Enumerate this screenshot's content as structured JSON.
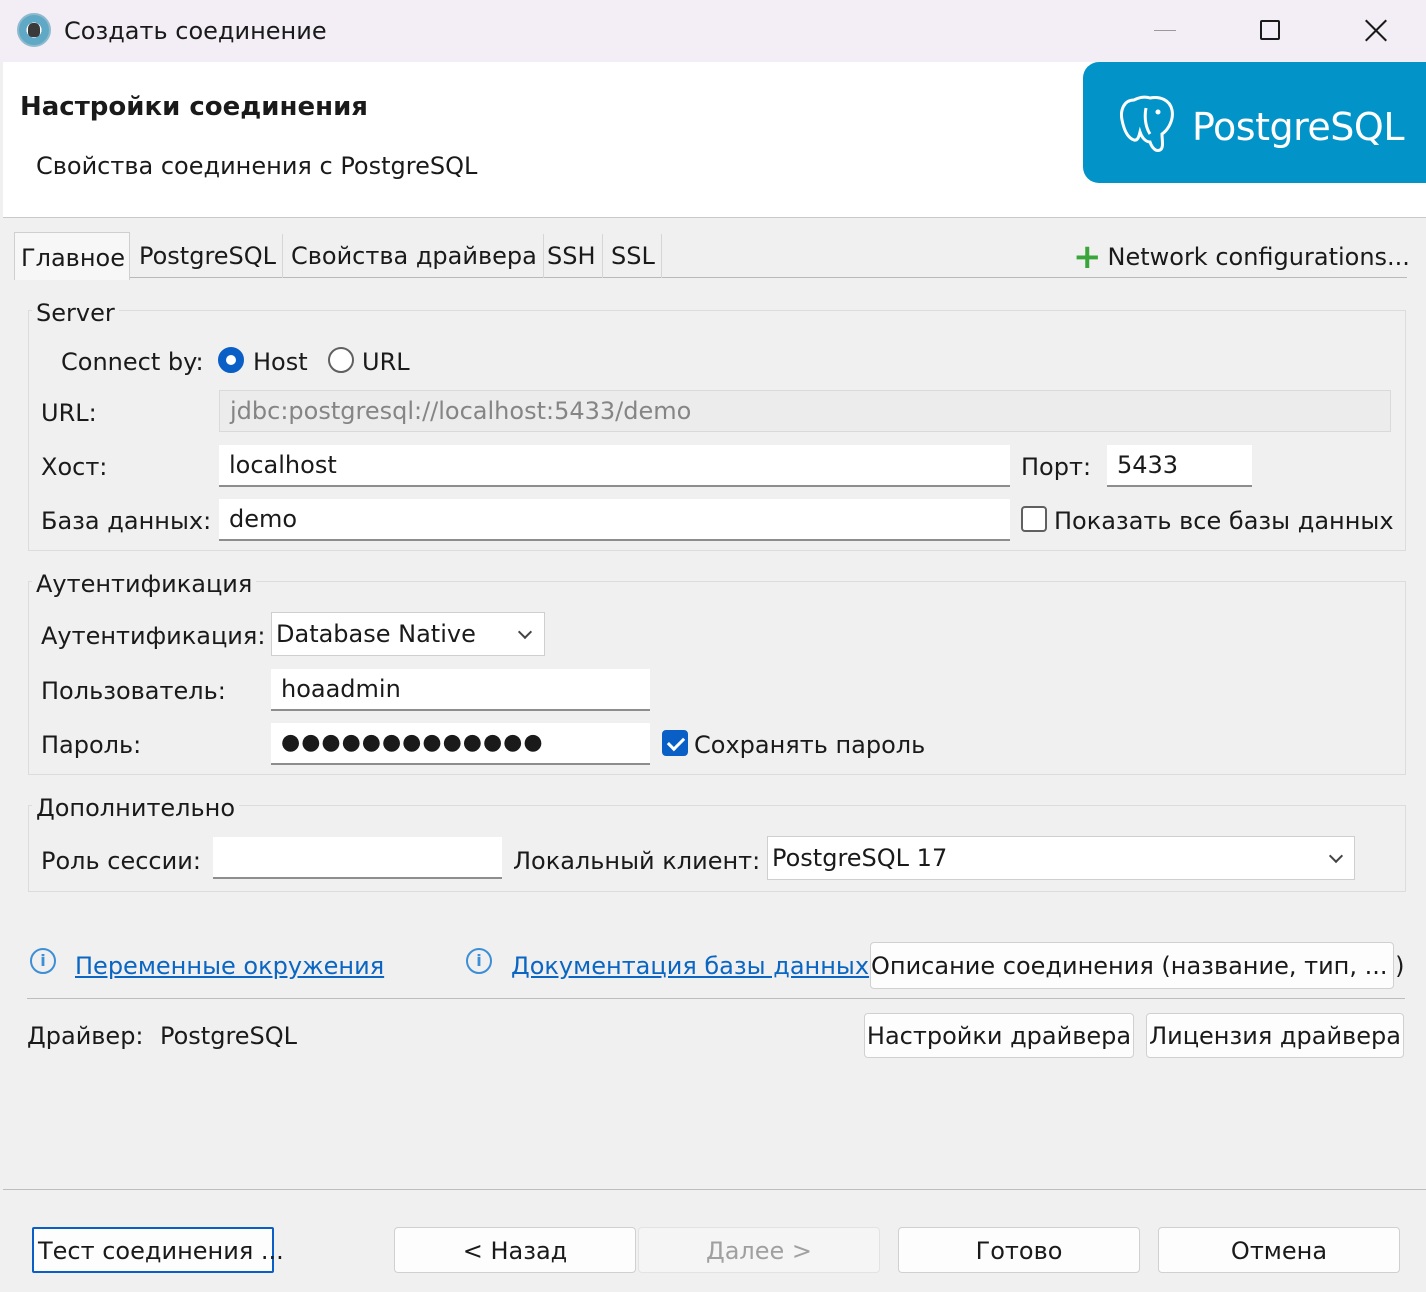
{
  "window": {
    "title": "Создать соединение"
  },
  "header": {
    "title": "Настройки соединения",
    "subtitle": "Свойства соединения с PostgreSQL",
    "logo_text": "PostgreSQL"
  },
  "tabs": [
    {
      "label": "Главное",
      "active": true
    },
    {
      "label": "PostgreSQL"
    },
    {
      "label": "Свойства драйвера"
    },
    {
      "label": "SSH"
    },
    {
      "label": "SSL"
    }
  ],
  "network_configurations": "Network configurations...",
  "server": {
    "group_title": "Server",
    "connect_by_label": "Connect by:",
    "connect_by_options": [
      "Host",
      "URL"
    ],
    "connect_by_selected": "Host",
    "url_label": "URL:",
    "url_value": "jdbc:postgresql://localhost:5433/demo",
    "host_label": "Хост:",
    "host_value": "localhost",
    "port_label": "Порт:",
    "port_value": "5433",
    "database_label": "База данных:",
    "database_value": "demo",
    "show_all_databases_label": "Показать все базы данных",
    "show_all_databases_checked": false
  },
  "auth": {
    "group_title": "Аутентификация",
    "auth_label": "Аутентификация:",
    "auth_value": "Database Native",
    "user_label": "Пользователь:",
    "user_value": "hoaadmin",
    "password_label": "Пароль:",
    "password_value": "●●●●●●●●●●●●●",
    "save_password_label": "Сохранять пароль",
    "save_password_checked": true
  },
  "advanced": {
    "group_title": "Дополнительно",
    "session_role_label": "Роль сессии:",
    "session_role_value": "",
    "local_client_label": "Локальный клиент:",
    "local_client_value": "PostgreSQL 17"
  },
  "links": {
    "env_vars": "Переменные окружения",
    "db_docs": "Документация базы данных"
  },
  "connection_description_button": "Описание соединения (название, тип, ... )",
  "driver": {
    "label": "Драйвер:",
    "value": "PostgreSQL",
    "settings_button": "Настройки драйвера",
    "license_button": "Лицензия драйвера"
  },
  "footer": {
    "test_button": "Тест соединения ...",
    "back_button": "< Назад",
    "next_button": "Далее >",
    "finish_button": "Готово",
    "cancel_button": "Отмена"
  },
  "colors": {
    "accent": "#0a5fc7",
    "link": "#0a66c2",
    "logo_bg": "#0294c8",
    "plus": "#3aa53a"
  }
}
